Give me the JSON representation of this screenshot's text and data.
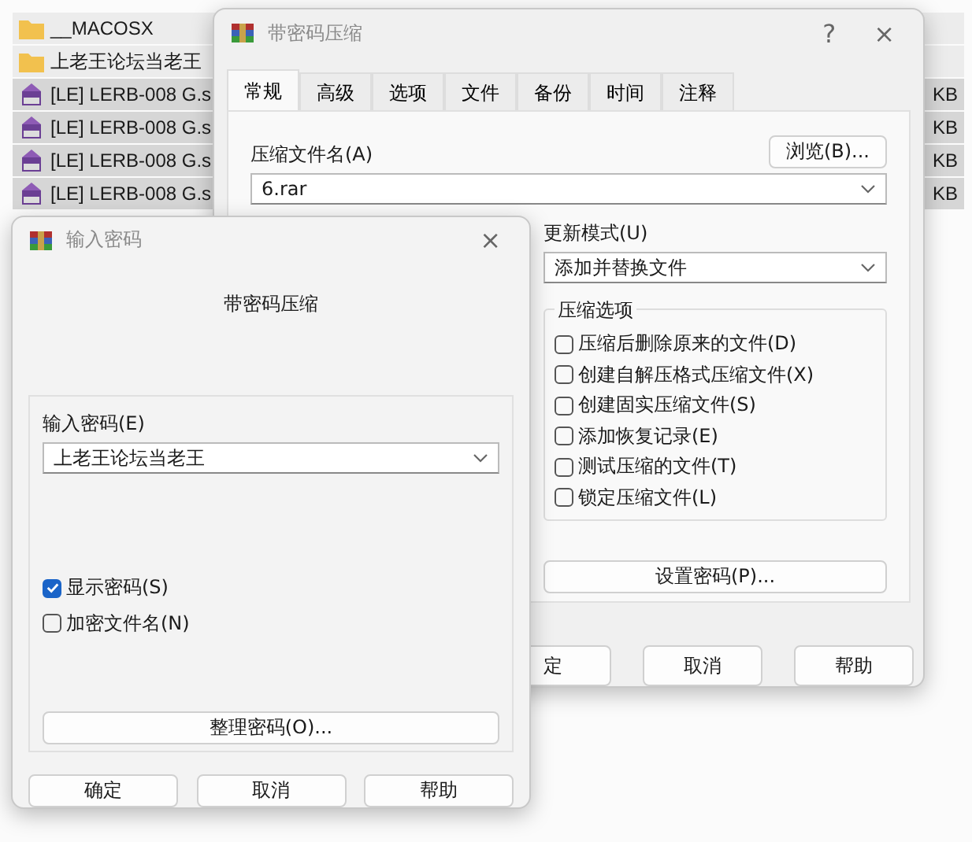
{
  "file_list": {
    "rows": [
      {
        "kind": "folder",
        "name": "__MACOSX",
        "selected": false
      },
      {
        "kind": "folder",
        "name": "上老王论坛当老王",
        "selected": false
      },
      {
        "kind": "archive",
        "name": "[LE] LERB-008 G.s",
        "size": "KB",
        "selected": true
      },
      {
        "kind": "archive",
        "name": "[LE] LERB-008 G.s",
        "size": "KB",
        "selected": true
      },
      {
        "kind": "archive",
        "name": "[LE] LERB-008 G.s",
        "size": "KB",
        "selected": true
      },
      {
        "kind": "archive",
        "name": "[LE] LERB-008 G.s",
        "size": "KB",
        "selected": true
      }
    ]
  },
  "archive_dialog": {
    "title": "带密码压缩",
    "help": "?",
    "close": "×",
    "tabs": [
      {
        "label": "常规",
        "selected": true
      },
      {
        "label": "高级",
        "selected": false
      },
      {
        "label": "选项",
        "selected": false
      },
      {
        "label": "文件",
        "selected": false
      },
      {
        "label": "备份",
        "selected": false
      },
      {
        "label": "时间",
        "selected": false
      },
      {
        "label": "注释",
        "selected": false
      }
    ],
    "archive_name_label": "压缩文件名(A)",
    "browse_button": "浏览(B)...",
    "archive_name": "6.rar",
    "update_mode_label": "更新模式(U)",
    "update_mode": "添加并替换文件",
    "options_title": "压缩选项",
    "options": [
      {
        "label": "压缩后删除原来的文件(D)",
        "checked": false
      },
      {
        "label": "创建自解压格式压缩文件(X)",
        "checked": false
      },
      {
        "label": "创建固实压缩文件(S)",
        "checked": false
      },
      {
        "label": "添加恢复记录(E)",
        "checked": false
      },
      {
        "label": "测试压缩的文件(T)",
        "checked": false
      },
      {
        "label": "锁定压缩文件(L)",
        "checked": false
      }
    ],
    "set_password_button": "设置密码(P)...",
    "buttons": [
      "定",
      "取消",
      "帮助"
    ]
  },
  "password_dialog": {
    "title": "输入密码",
    "close": "×",
    "heading": "带密码压缩",
    "password_label": "输入密码(E)",
    "password": "上老王论坛当老王",
    "options": [
      {
        "label": "显示密码(S)",
        "checked": true
      },
      {
        "label": "加密文件名(N)",
        "checked": false
      }
    ],
    "organize_button": "整理密码(O)...",
    "buttons": [
      "确定",
      "取消",
      "帮助"
    ]
  }
}
